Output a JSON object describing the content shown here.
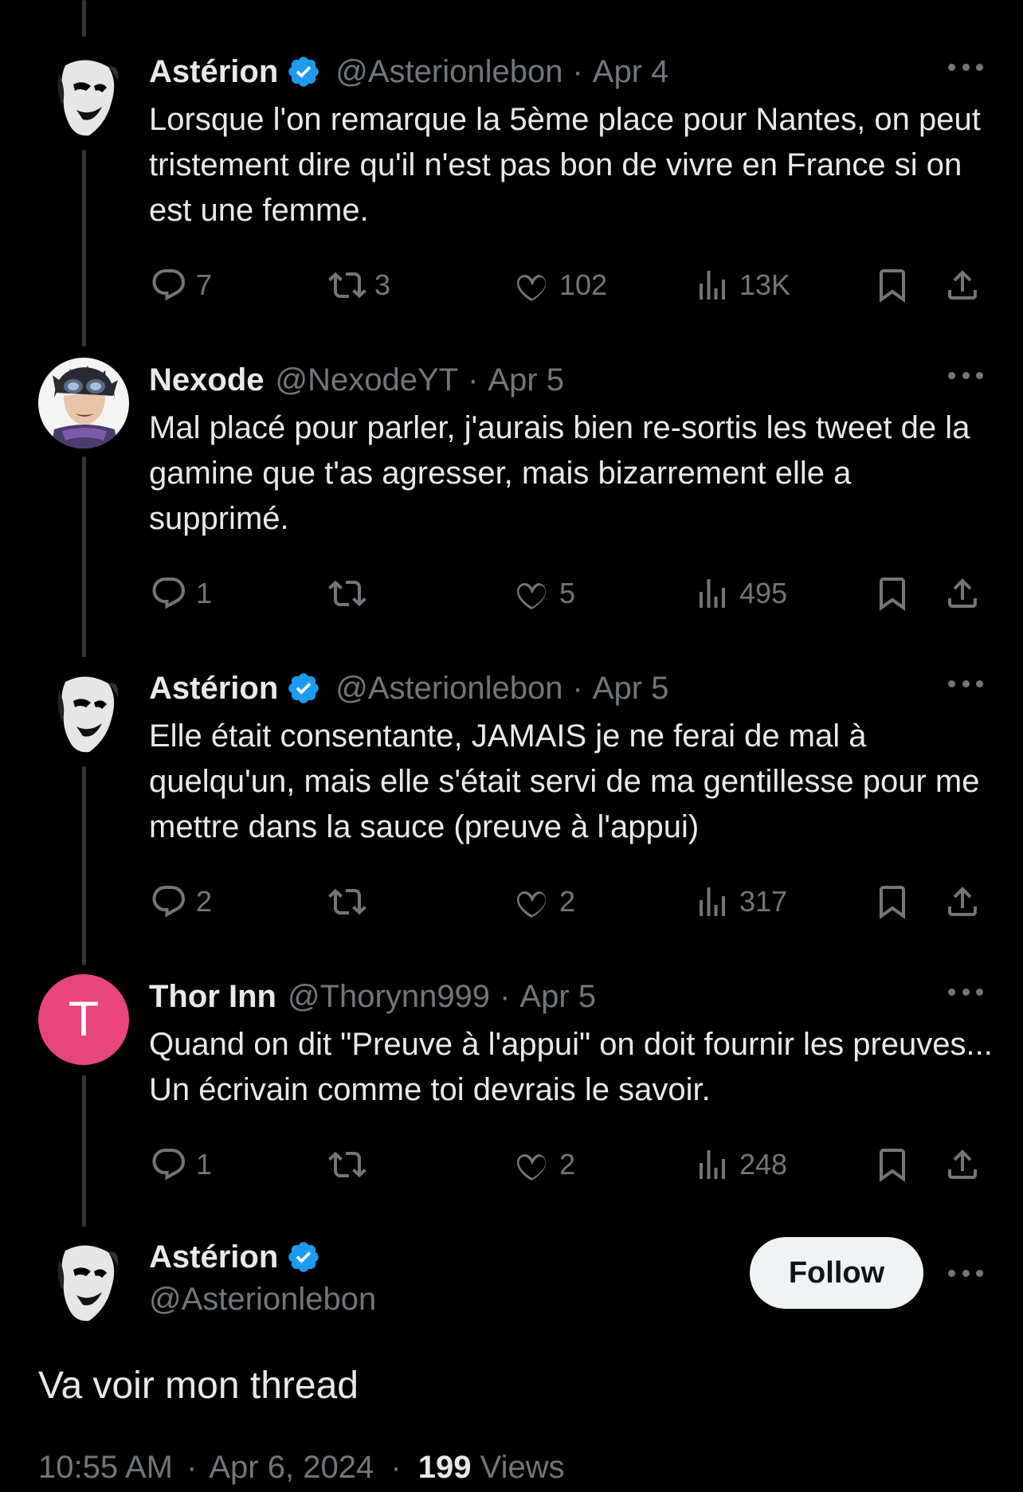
{
  "colors": {
    "background": "#000000",
    "text_primary": "#e7e9ea",
    "text_secondary": "#71767b",
    "verified_blue": "#1d9bf0",
    "thread_line": "#333639",
    "avatar_thor": "#e8457d"
  },
  "replies": [
    {
      "name": "Astérion",
      "verified": true,
      "handle": "@Asterionlebon",
      "date": "Apr 4",
      "text": "Lorsque l'on remarque la 5ème place pour Nantes, on peut tristement dire qu'il n'est pas bon de vivre en France si on est une femme.",
      "avatar": "masked-face-avatar",
      "stats": {
        "replies": "7",
        "reposts": "3",
        "likes": "102",
        "views": "13K"
      }
    },
    {
      "name": "Nexode",
      "verified": false,
      "handle": "@NexodeYT",
      "date": "Apr 5",
      "text": "Mal placé pour parler, j'aurais bien re-sortis les tweet de la gamine que t'as agresser, mais bizarrement elle a supprimé.",
      "avatar": "goggles-character-avatar",
      "stats": {
        "replies": "1",
        "reposts": "",
        "likes": "5",
        "views": "495"
      }
    },
    {
      "name": "Astérion",
      "verified": true,
      "handle": "@Asterionlebon",
      "date": "Apr 5",
      "text": "Elle était consentante, JAMAIS je ne ferai de mal à quelqu'un, mais elle s'était servi de ma gentillesse pour me mettre dans la sauce (preuve à l'appui)",
      "avatar": "masked-face-avatar",
      "stats": {
        "replies": "2",
        "reposts": "",
        "likes": "2",
        "views": "317"
      }
    },
    {
      "name": "Thor Inn",
      "verified": false,
      "handle": "@Thorynn999",
      "date": "Apr 5",
      "text": "Quand on dit \"Preuve à l'appui\" on doit fournir les preuves...  Un écrivain comme toi devrais le savoir.",
      "avatar_letter": "T",
      "stats": {
        "replies": "1",
        "reposts": "",
        "likes": "2",
        "views": "248"
      }
    }
  ],
  "main_tweet": {
    "name": "Astérion",
    "verified": true,
    "handle": "@Asterionlebon",
    "follow_label": "Follow",
    "text": "Va voir mon thread",
    "time": "10:55 AM",
    "date": "Apr 6, 2024",
    "views_count": "199",
    "views_label": "Views",
    "separator": "·"
  },
  "icons": [
    "reply-icon",
    "repost-icon",
    "like-icon",
    "views-icon",
    "bookmark-icon",
    "share-icon",
    "more-icon",
    "verified-badge-icon"
  ]
}
